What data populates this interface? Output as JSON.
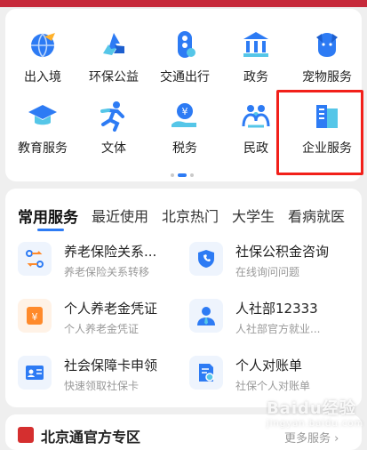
{
  "colors": {
    "accent": "#2d7bf4",
    "highlight": "#f2201a",
    "brand_red": "#c6293a"
  },
  "grid": {
    "items": [
      {
        "label": "出入境",
        "icon": "globe-plane-icon"
      },
      {
        "label": "环保公益",
        "icon": "recycle-icon"
      },
      {
        "label": "交通出行",
        "icon": "traffic-light-icon"
      },
      {
        "label": "政务",
        "icon": "government-building-icon"
      },
      {
        "label": "宠物服务",
        "icon": "pet-dog-icon"
      },
      {
        "label": "教育服务",
        "icon": "graduation-cap-icon"
      },
      {
        "label": "文体",
        "icon": "running-person-icon"
      },
      {
        "label": "税务",
        "icon": "tax-hand-icon"
      },
      {
        "label": "民政",
        "icon": "family-people-icon"
      },
      {
        "label": "企业服务",
        "icon": "office-building-icon"
      }
    ],
    "page_indicator": {
      "pages": 3,
      "active": 1
    }
  },
  "services": {
    "tabs": [
      "常用服务",
      "最近使用",
      "北京热门",
      "大学生",
      "看病就医"
    ],
    "active_tab": 0,
    "items": [
      {
        "title": "养老保险关系...",
        "subtitle": "养老保险关系转移",
        "icon": "pension-transfer-icon"
      },
      {
        "title": "社保公积金咨询",
        "subtitle": "在线询问问题",
        "icon": "phone-shield-icon"
      },
      {
        "title": "个人养老金凭证",
        "subtitle": "个人养老金凭证",
        "icon": "yuan-certificate-icon"
      },
      {
        "title": "人社部12333",
        "subtitle": "人社部官方就业...",
        "icon": "user-tie-icon"
      },
      {
        "title": "社会保障卡申领",
        "subtitle": "快速领取社保卡",
        "icon": "id-card-icon"
      },
      {
        "title": "个人对账单",
        "subtitle": "社保个人对账单",
        "icon": "statement-search-icon"
      }
    ]
  },
  "bottom": {
    "title": "北京通官方专区",
    "more": "更多服务"
  },
  "watermark": {
    "text": "Baidu经验",
    "sub": "jingyan.baidu.com"
  }
}
